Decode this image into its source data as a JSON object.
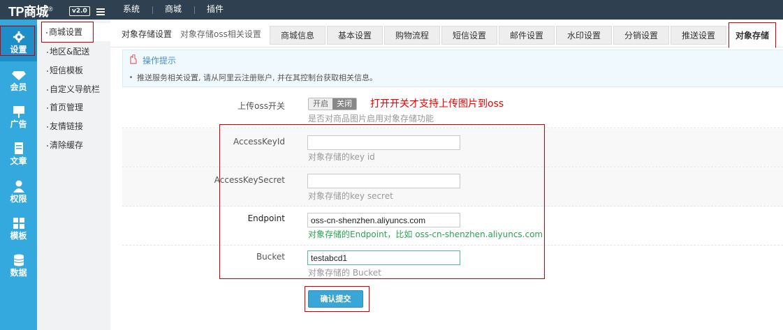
{
  "brand": {
    "logo_text": "TP商城",
    "registered": "®",
    "version": "v2.0"
  },
  "top_nav": [
    "系统",
    "商城",
    "插件"
  ],
  "rail": [
    {
      "label": "设置",
      "icon": "gear-icon",
      "active": true
    },
    {
      "label": "会员",
      "icon": "diamond-icon"
    },
    {
      "label": "广告",
      "icon": "billboard-icon"
    },
    {
      "label": "文章",
      "icon": "document-icon"
    },
    {
      "label": "权限",
      "icon": "user-icon"
    },
    {
      "label": "模板",
      "icon": "grid-icon"
    },
    {
      "label": "数据",
      "icon": "database-icon"
    }
  ],
  "submenu": [
    "商城设置",
    "地区&配送",
    "短信模板",
    "自定义导航栏",
    "首页管理",
    "友情链接",
    "清除缓存"
  ],
  "page": {
    "title": "对象存储设置",
    "subtitle": "对象存储oss相关设置"
  },
  "tabs": [
    "商城信息",
    "基本设置",
    "购物流程",
    "短信设置",
    "邮件设置",
    "水印设置",
    "分销设置",
    "推送设置",
    "对象存储"
  ],
  "tip": {
    "title": "操作提示",
    "text": "推送服务相关设置, 请从阿里云注册账户, 并在其控制台获取相关信息。"
  },
  "form": {
    "oss_switch": {
      "label": "上传oss开关",
      "on": "开启",
      "off": "关闭",
      "hint": "是否对商品图片启用对象存储功能",
      "annotation": "打开开关才支持上传图片到oss"
    },
    "access_key_id": {
      "label": "AccessKeyId",
      "value": "",
      "hint": "对象存储的key id"
    },
    "access_key_secret": {
      "label": "AccessKeySecret",
      "value": "",
      "hint": "对象存储的key secret"
    },
    "endpoint": {
      "label": "Endpoint",
      "value": "oss-cn-shenzhen.aliyuncs.com",
      "hint": "对象存储的Endpoint，比如 oss-cn-shenzhen.aliyuncs.com"
    },
    "bucket": {
      "label": "Bucket",
      "value": "testabcd1",
      "hint": "对象存储的 Bucket"
    },
    "submit": "确认提交"
  },
  "colors": {
    "rail": "#33a9dd",
    "topbar": "#2f4050",
    "highlight": "#cc0000",
    "button": "#3aa6d8"
  }
}
